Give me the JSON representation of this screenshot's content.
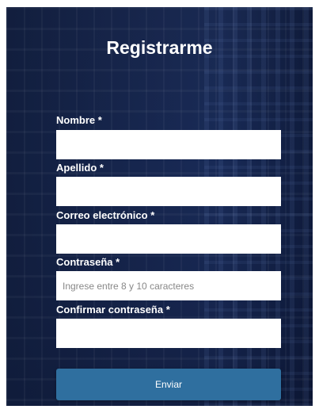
{
  "form": {
    "title": "Registrarme",
    "fields": [
      {
        "label": "Nombre *",
        "value": "",
        "placeholder": ""
      },
      {
        "label": "Apellido *",
        "value": "",
        "placeholder": ""
      },
      {
        "label": "Correo electrónico *",
        "value": "",
        "placeholder": ""
      },
      {
        "label": "Contraseña *",
        "value": "",
        "placeholder": "Ingrese entre 8 y 10 caracteres"
      },
      {
        "label": "Confirmar contraseña *",
        "value": "",
        "placeholder": ""
      }
    ],
    "submit_label": "Enviar"
  },
  "colors": {
    "background": "#1a2c5a",
    "button": "#2f6f9f",
    "text": "#ffffff"
  }
}
